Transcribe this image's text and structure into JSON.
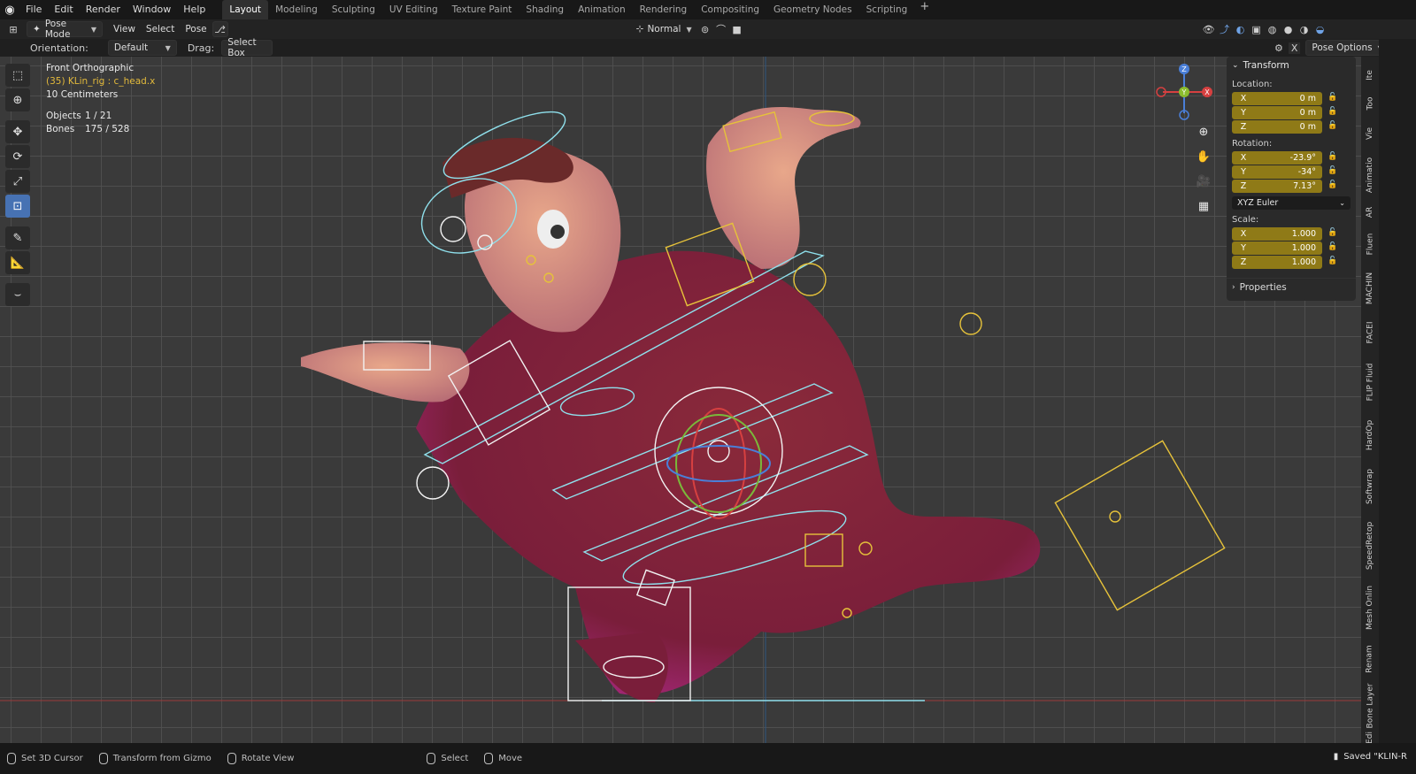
{
  "menu": [
    "File",
    "Edit",
    "Render",
    "Window",
    "Help"
  ],
  "workspaces": [
    {
      "label": "Layout",
      "active": true
    },
    {
      "label": "Modeling"
    },
    {
      "label": "Sculpting"
    },
    {
      "label": "UV Editing"
    },
    {
      "label": "Texture Paint"
    },
    {
      "label": "Shading"
    },
    {
      "label": "Animation"
    },
    {
      "label": "Rendering"
    },
    {
      "label": "Compositing"
    },
    {
      "label": "Geometry Nodes"
    },
    {
      "label": "Scripting"
    }
  ],
  "header": {
    "mode": "Pose Mode",
    "menus": [
      "View",
      "Select",
      "Pose"
    ],
    "transform_orientation": "Normal",
    "orientation_label": "Orientation:",
    "orientation_value": "Default",
    "drag_label": "Drag:",
    "drag_value": "Select Box",
    "pose_options": "Pose Options",
    "x_label": "X"
  },
  "viewport": {
    "view_name": "Front Orthographic",
    "active_object": "(35) KLin_rig : c_head.x",
    "grid_scale": "10 Centimeters",
    "objects_label": "Objects",
    "objects_value": "1 / 21",
    "bones_label": "Bones",
    "bones_value": "175 / 528"
  },
  "gizmo": {
    "x": "X",
    "y": "Y",
    "z": "Z"
  },
  "npanel": {
    "transform_title": "Transform",
    "location_label": "Location:",
    "location": [
      {
        "axis": "X",
        "value": "0 m"
      },
      {
        "axis": "Y",
        "value": "0 m"
      },
      {
        "axis": "Z",
        "value": "0 m"
      }
    ],
    "rotation_label": "Rotation:",
    "rotation": [
      {
        "axis": "X",
        "value": "-23.9°"
      },
      {
        "axis": "Y",
        "value": "-34°"
      },
      {
        "axis": "Z",
        "value": "7.13°"
      }
    ],
    "rotation_mode": "XYZ Euler",
    "scale_label": "Scale:",
    "scale": [
      {
        "axis": "X",
        "value": "1.000"
      },
      {
        "axis": "Y",
        "value": "1.000"
      },
      {
        "axis": "Z",
        "value": "1.000"
      }
    ],
    "properties_title": "Properties"
  },
  "side_tabs": [
    "Ite",
    "Too",
    "Vie",
    "Animatio",
    "AR",
    "Fluen",
    "MACHIN",
    "FACEI",
    "FLIP Fluid",
    "HardOp",
    "Softwrap",
    "SpeedRetop",
    "Mesh Onlin",
    "Renam",
    "Bone Layer",
    "Edi"
  ],
  "status": {
    "items": [
      "Set 3D Cursor",
      "Transform from Gizmo",
      "Rotate View",
      "Select",
      "Move"
    ],
    "right": "Saved \"KLIN-R"
  },
  "colors": {
    "accent": "#4772b3",
    "field": "#8f7a17",
    "rig_yellow": "#e6c23a",
    "rig_cyan": "#8fe0ec"
  }
}
